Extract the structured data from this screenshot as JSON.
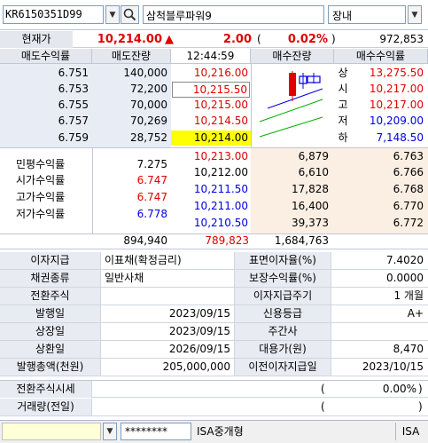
{
  "header": {
    "code": "KR6150351D99",
    "name": "삼척블루파워9",
    "market": "장내"
  },
  "price": {
    "label": "현재가",
    "current": "10,214.00",
    "change_arrow": "▲",
    "change": "2.00",
    "paren_open": "(",
    "rate": "0.02%",
    "paren_close": ")",
    "volume": "972,853"
  },
  "columns": {
    "sell_yield": "매도수익률",
    "sell_qty": "매도잔량",
    "time": "12:44:59",
    "buy_qty": "매수잔량",
    "buy_yield": "매수수익률"
  },
  "asks": [
    {
      "yield": "6.751",
      "qty": "140,000",
      "price": "10,216.00"
    },
    {
      "yield": "6.753",
      "qty": "72,200",
      "price": "10,215.50"
    },
    {
      "yield": "6.755",
      "qty": "70,000",
      "price": "10,215.00"
    },
    {
      "yield": "6.757",
      "qty": "70,269",
      "price": "10,214.50"
    },
    {
      "yield": "6.759",
      "qty": "28,752",
      "price": "10,214.00"
    }
  ],
  "bids": [
    {
      "price": "10,213.00",
      "qty": "6,879",
      "yield": "6.763"
    },
    {
      "price": "10,212.00",
      "qty": "6,610",
      "yield": "6.766"
    },
    {
      "price": "10,211.50",
      "qty": "17,828",
      "yield": "6.768"
    },
    {
      "price": "10,211.00",
      "qty": "16,400",
      "yield": "6.770"
    },
    {
      "price": "10,210.50",
      "qty": "39,373",
      "yield": "6.772"
    }
  ],
  "limits": [
    {
      "label": "상",
      "value": "13,275.50"
    },
    {
      "label": "시",
      "value": "10,217.00"
    },
    {
      "label": "고",
      "value": "10,217.00"
    },
    {
      "label": "저",
      "value": "10,209.00"
    },
    {
      "label": "하",
      "value": "7,148.50"
    }
  ],
  "yields": [
    {
      "label": "민평수익률",
      "value": "7.275"
    },
    {
      "label": "시가수익률",
      "value": "6.747"
    },
    {
      "label": "고가수익률",
      "value": "6.747"
    },
    {
      "label": "저가수익률",
      "value": "6.778"
    }
  ],
  "totals": {
    "sell": "894,940",
    "diff": "789,823",
    "buy": "1,684,763"
  },
  "bond": {
    "interest_pay_label": "이자지급",
    "interest_pay_value": "이표채(확정금리)",
    "coupon_label": "표면이자율(%)",
    "coupon_value": "7.4020",
    "bond_type_label": "채권종류",
    "bond_type_value": "일반사채",
    "guarantee_label": "보장수익률(%)",
    "guarantee_value": "0.0000",
    "conv_stock_label": "전환주식",
    "conv_stock_value": "",
    "interest_cycle_label": "이자지급주기",
    "interest_cycle_value": "1 개월",
    "issue_date_label": "발행일",
    "issue_date_value": "2023/09/15",
    "credit_label": "신용등급",
    "credit_value": "A+",
    "listing_label": "상장일",
    "listing_value": "2023/09/15",
    "underwriter_label": "주간사",
    "underwriter_value": "",
    "maturity_label": "상환일",
    "maturity_value": "2026/09/15",
    "substitute_label": "대용가(원)",
    "substitute_value": "8,470",
    "issue_amount_label": "발행총액(천원)",
    "issue_amount_value": "205,000,000",
    "prev_interest_label": "이전이자지급일",
    "prev_interest_value": "2023/10/15",
    "conv_price_label": "전환주식시세",
    "conv_price_paren": "(",
    "conv_price_rate": "0.00%",
    "conv_price_paren_close": ")",
    "prev_volume_label": "거래량(전일)",
    "prev_volume_paren": "(",
    "prev_volume_paren_close": ")"
  },
  "footer": {
    "password": "********",
    "isa_label": "ISA중개형",
    "isa_short": "ISA"
  },
  "colors": {
    "up": "#e00000",
    "down": "#0000e0",
    "highlight": "#ffff00",
    "sell_bg": "#e8ecf5",
    "buy_bg": "#fbefe3"
  }
}
